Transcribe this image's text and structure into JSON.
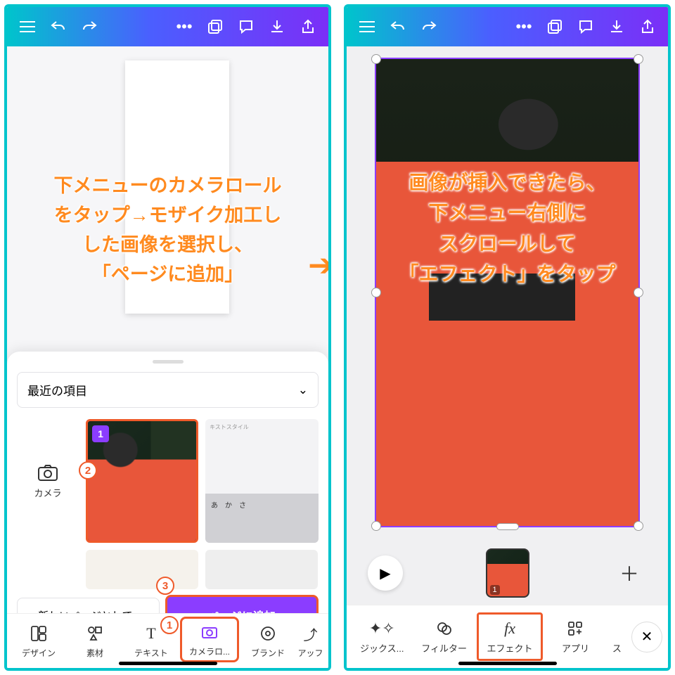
{
  "left": {
    "instruction": "下メニューのカメラロール\nをタップ→モザイク加工し\nした画像を選択し、\n「ページに追加」",
    "dropdown": "最近の項目",
    "camera_tile": "カメラ",
    "thumb_badge": "1",
    "new_page_btn": "新しいページとして..",
    "add_btn": "ページに追加",
    "tabs": [
      {
        "label": "デザイン"
      },
      {
        "label": "素材"
      },
      {
        "label": "テキスト"
      },
      {
        "label": "カメラロ..."
      },
      {
        "label": "ブランド"
      },
      {
        "label": "アッフ"
      }
    ],
    "circles": {
      "c1": "1",
      "c2": "2",
      "c3": "3"
    },
    "mini_label": "キストスタイル",
    "mini_keys": "あ　か　さ"
  },
  "right": {
    "instruction": "画像が挿入できたら、\n下メニュー右側に\nスクロールして\n「エフェクト」をタップ",
    "timeline_badge": "1",
    "tabs": [
      {
        "label": "ジックス..."
      },
      {
        "label": "フィルター"
      },
      {
        "label": "エフェクト"
      },
      {
        "label": "アプリ"
      },
      {
        "label": "ス"
      }
    ]
  }
}
